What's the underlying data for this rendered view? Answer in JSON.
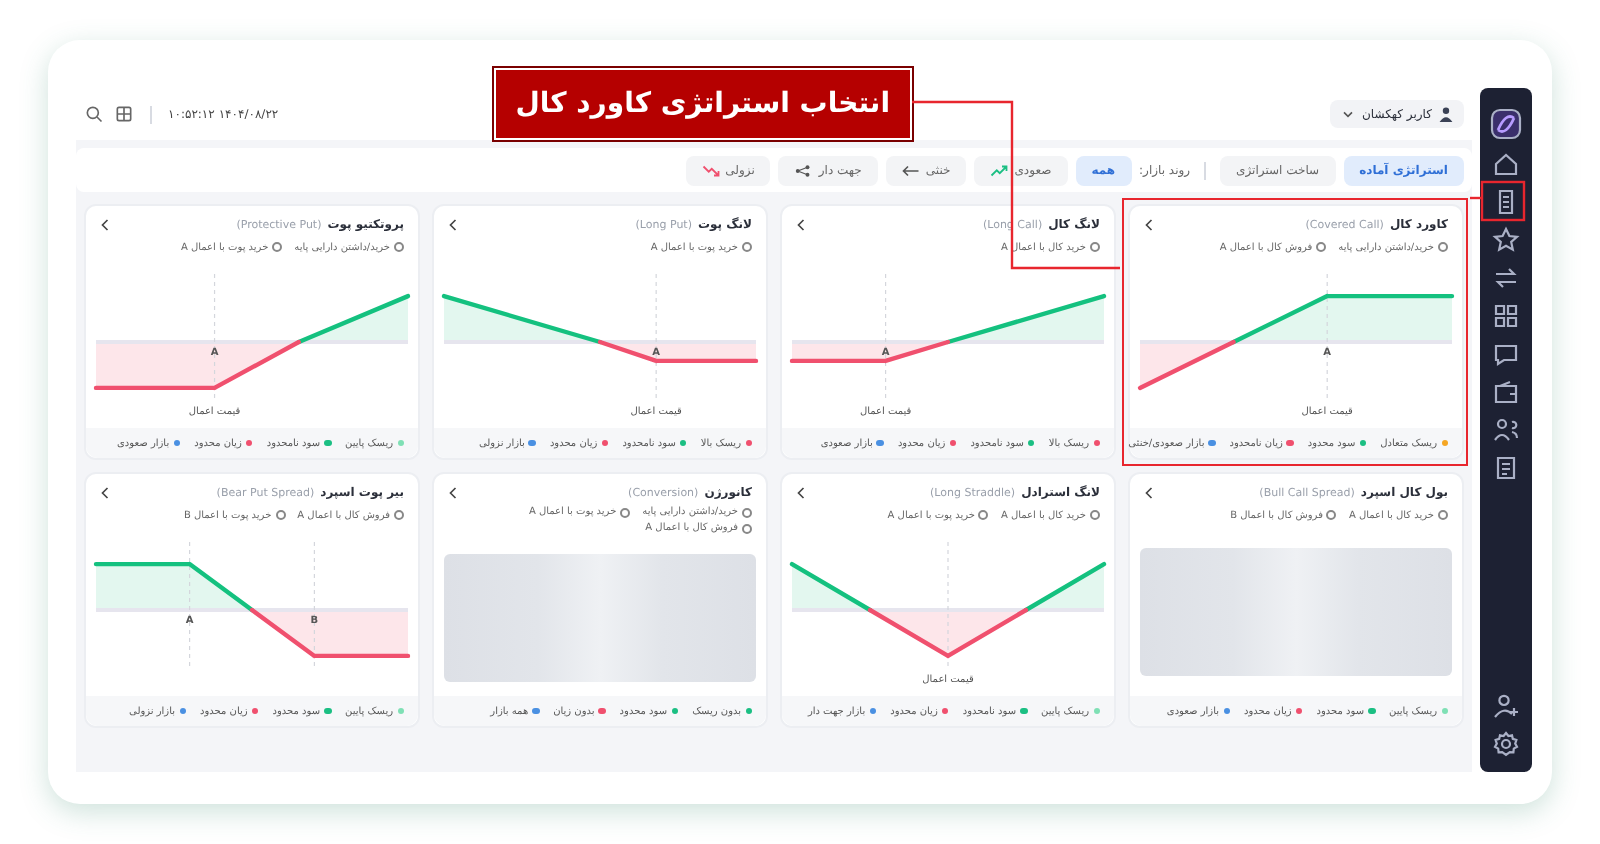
{
  "header": {
    "user": "کاربر کهکشان",
    "datetime": "۱۴۰۴/۰۸/۲۲ ۱۰:۵۲:۱۲"
  },
  "callout": {
    "text": "انتخاب استراتژی کاورد کال"
  },
  "tabs": [
    {
      "label": "استراتژی آماده",
      "selected": true
    },
    {
      "label": "ساخت استراتژی",
      "selected": false
    }
  ],
  "trend_filter": {
    "label": "روند بازار:",
    "options": [
      {
        "label": "همه",
        "selected": true
      },
      {
        "label": "صعودی",
        "selected": false
      },
      {
        "label": "خنثی",
        "selected": false
      },
      {
        "label": "جهت دار",
        "selected": false
      },
      {
        "label": "نزولی",
        "selected": false
      }
    ]
  },
  "cards": [
    {
      "title": "کاورد کال",
      "subtitle": "(Covered Call)",
      "highlighted": true,
      "legs": [
        "خرید/داشتن دارایی پایه",
        "فروش کال با اعمال A"
      ],
      "chart": {
        "kind": "covered_call",
        "strikes": [
          "A"
        ],
        "axis_label": "قیمت اعمال"
      },
      "tags": [
        {
          "label": "ریسک متعادل",
          "color": "#f5a623"
        },
        {
          "label": "سود محدود",
          "color": "#1bbf83"
        },
        {
          "label": "زیان نامحدود",
          "color": "#f0506e"
        },
        {
          "label": "بازار صعودی/خنثی",
          "color": "#4a90e2"
        }
      ]
    },
    {
      "title": "لانگ کال",
      "subtitle": "(Long Call)",
      "highlighted": false,
      "legs": [
        "خرید کال با اعمال A"
      ],
      "chart": {
        "kind": "long_call",
        "strikes": [
          "A"
        ],
        "axis_label": "قیمت اعمال"
      },
      "tags": [
        {
          "label": "ریسک بالا",
          "color": "#f0506e"
        },
        {
          "label": "سود نامحدود",
          "color": "#1bbf83"
        },
        {
          "label": "زیان محدود",
          "color": "#f0506e"
        },
        {
          "label": "بازار صعودی",
          "color": "#4a90e2"
        }
      ]
    },
    {
      "title": "لانگ پوت",
      "subtitle": "(Long Put)",
      "highlighted": false,
      "legs": [
        "خرید پوت با اعمال A"
      ],
      "chart": {
        "kind": "long_put",
        "strikes": [
          "A"
        ],
        "axis_label": "قیمت اعمال"
      },
      "tags": [
        {
          "label": "ریسک بالا",
          "color": "#f0506e"
        },
        {
          "label": "سود نامحدود",
          "color": "#1bbf83"
        },
        {
          "label": "زیان محدود",
          "color": "#f0506e"
        },
        {
          "label": "بازار نزولی",
          "color": "#4a90e2"
        }
      ]
    },
    {
      "title": "پروتکتیو پوت",
      "subtitle": "(Protective Put)",
      "highlighted": false,
      "legs": [
        "خرید/داشتن دارایی پایه",
        "خرید پوت با اعمال A"
      ],
      "chart": {
        "kind": "protective_put",
        "strikes": [
          "A"
        ],
        "axis_label": "قیمت اعمال"
      },
      "tags": [
        {
          "label": "ریسک پایین",
          "color": "#7fe0b5"
        },
        {
          "label": "سود نامحدود",
          "color": "#1bbf83"
        },
        {
          "label": "زیان محدود",
          "color": "#f0506e"
        },
        {
          "label": "بازار صعودی",
          "color": "#4a90e2"
        }
      ]
    },
    {
      "title": "بول کال اسپرد",
      "subtitle": "(Bull Call Spread)",
      "highlighted": false,
      "legs": [
        "خرید کال با اعمال A",
        "فروش کال با اعمال B"
      ],
      "chart": {
        "kind": "placeholder"
      },
      "tags": [
        {
          "label": "ریسک پایین",
          "color": "#7fe0b5"
        },
        {
          "label": "سود محدود",
          "color": "#1bbf83"
        },
        {
          "label": "زیان محدود",
          "color": "#f0506e"
        },
        {
          "label": "بازار صعودی",
          "color": "#4a90e2"
        }
      ]
    },
    {
      "title": "لانگ استرادل",
      "subtitle": "(Long Straddle)",
      "highlighted": false,
      "legs": [
        "خرید کال با اعمال A",
        "خرید پوت با اعمال A"
      ],
      "chart": {
        "kind": "long_straddle",
        "axis_label": "قیمت اعمال"
      },
      "tags": [
        {
          "label": "ریسک پایین",
          "color": "#7fe0b5"
        },
        {
          "label": "سود نامحدود",
          "color": "#1bbf83"
        },
        {
          "label": "زیان محدود",
          "color": "#f0506e"
        },
        {
          "label": "بازار جهت دار",
          "color": "#4a90e2"
        }
      ]
    },
    {
      "title": "کانورژن",
      "subtitle": "(Conversion)",
      "highlighted": false,
      "legs": [
        "خرید/داشتن دارایی پایه",
        "خرید پوت با اعمال A",
        "فروش کال با اعمال A"
      ],
      "chart": {
        "kind": "placeholder"
      },
      "tags": [
        {
          "label": "بدون ریسک",
          "color": "#1bbf83"
        },
        {
          "label": "سود محدود",
          "color": "#1bbf83"
        },
        {
          "label": "بدون زیان",
          "color": "#f0506e"
        },
        {
          "label": "همه بازار",
          "color": "#4a90e2"
        }
      ]
    },
    {
      "title": "بیر پوت اسپرد",
      "subtitle": "(Bear Put Spread)",
      "highlighted": false,
      "legs": [
        "فروش کال با اعمال A",
        "خرید پوت با اعمال B"
      ],
      "chart": {
        "kind": "bear_put_spread",
        "strikes": [
          "B",
          "A"
        ]
      },
      "tags": [
        {
          "label": "ریسک پایین",
          "color": "#7fe0b5"
        },
        {
          "label": "سود محدود",
          "color": "#1bbf83"
        },
        {
          "label": "زیان محدود",
          "color": "#f0506e"
        },
        {
          "label": "بازار نزولی",
          "color": "#4a90e2"
        }
      ]
    }
  ]
}
